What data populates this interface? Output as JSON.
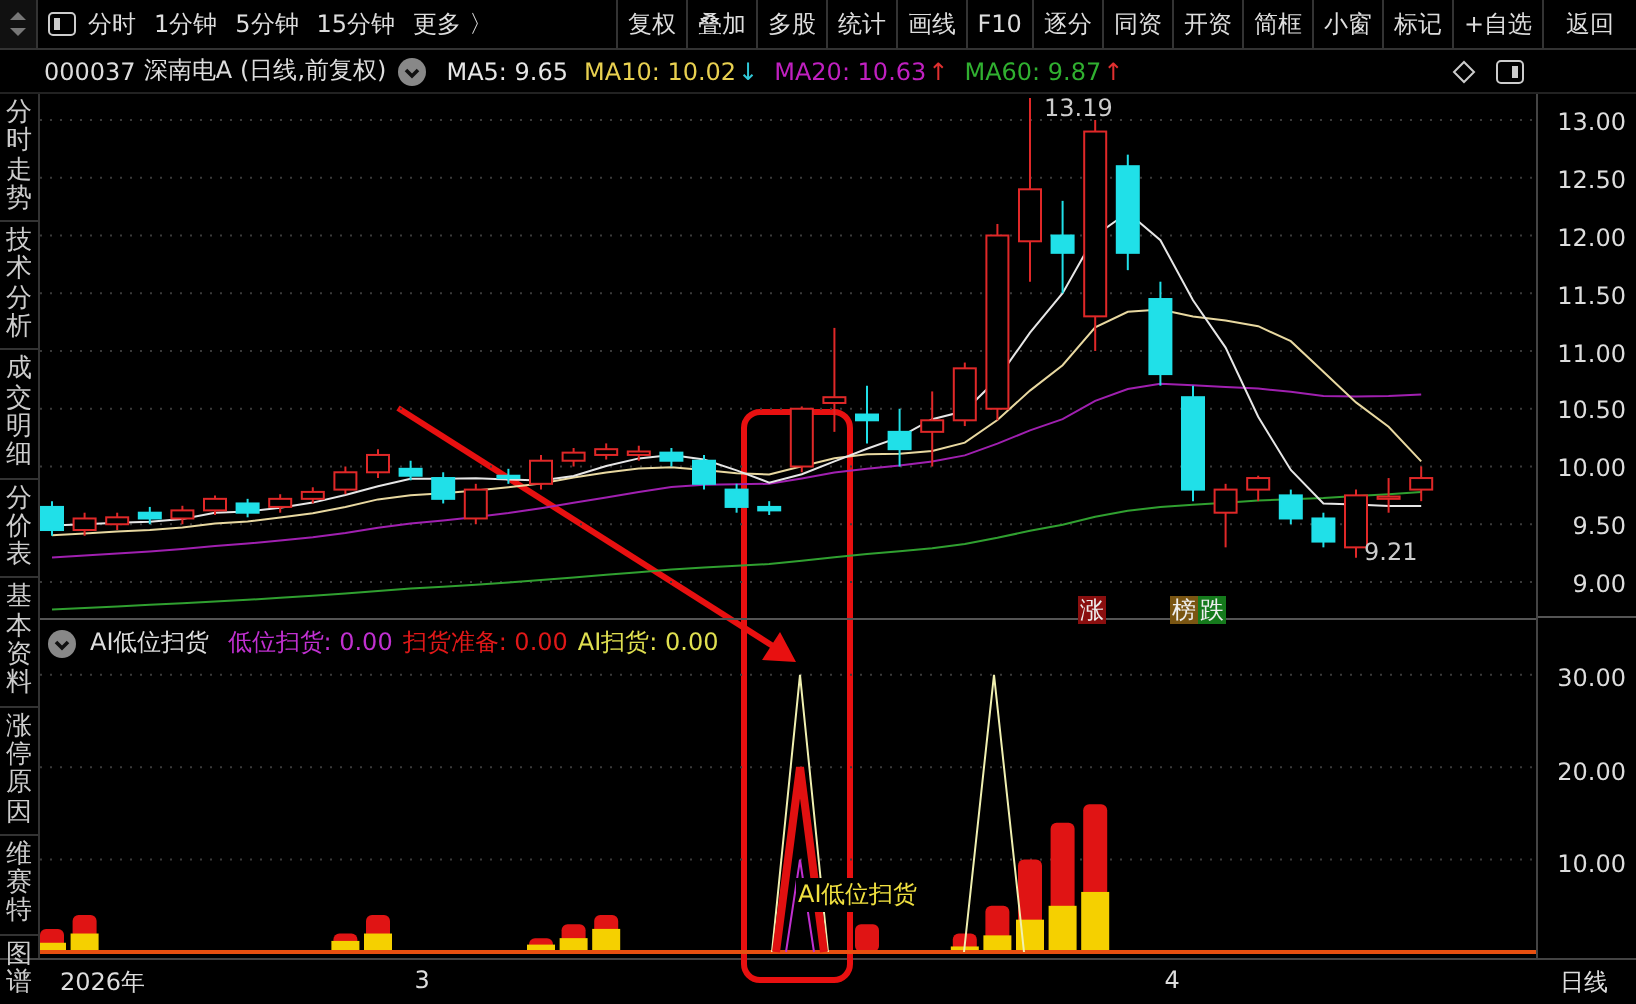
{
  "toolbar": {
    "periods": [
      "分时",
      "1分钟",
      "5分钟",
      "15分钟",
      "更多 〉"
    ],
    "buttons": [
      "复权",
      "叠加",
      "多股",
      "统计",
      "画线",
      "F10",
      "逐分",
      "同资",
      "开资",
      "简框",
      "小窗",
      "标记",
      "+自选",
      "返回"
    ]
  },
  "stock_header": {
    "code": "000037",
    "name": "深南电A",
    "mode": "(日线,前复权)",
    "averages": [
      {
        "label": "MA5: 9.65",
        "color": "#e6e6e6"
      },
      {
        "label": "MA10: 10.02",
        "color": "#e8d050",
        "arrow": {
          "text": "↓",
          "color": "#30c8d8"
        }
      },
      {
        "label": "MA20: 10.63",
        "color": "#c020c0",
        "arrow": {
          "text": "↑",
          "color": "#e03030"
        }
      },
      {
        "label": "MA60: 9.87",
        "color": "#30b030",
        "arrow": {
          "text": "↑",
          "color": "#e03030"
        }
      }
    ]
  },
  "sidebar": {
    "tabs": [
      "分时走势",
      "技术分析",
      "成交明细",
      "分价表",
      "基本资料",
      "涨停原因",
      "维赛特",
      "图谱"
    ]
  },
  "price_chart": {
    "axis": [
      "13.00",
      "12.50",
      "12.00",
      "11.50",
      "11.00",
      "10.50",
      "10.00",
      "9.50",
      "9.00"
    ],
    "high_label": "13.19",
    "low_label": "9.21",
    "badges": [
      {
        "text": "涨",
        "color": "#8a0f0f"
      },
      {
        "text": "榜",
        "color": "#7a5512"
      },
      {
        "text": "跌",
        "color": "#157a1c"
      }
    ]
  },
  "indicator": {
    "title": "AI低位扫货",
    "series": [
      {
        "label": "低位扫货: 0.00",
        "color": "#c030d0"
      },
      {
        "label": "扫货准备: 0.00",
        "color": "#e01818"
      },
      {
        "label": "AI扫货: 0.00",
        "color": "#e0e050"
      }
    ],
    "axis": [
      "30.00",
      "20.00",
      "10.00"
    ],
    "signal_label": "AI低位扫货"
  },
  "date_axis": {
    "labels": [
      "2026年",
      "3",
      "4"
    ],
    "period": "日线"
  }
}
